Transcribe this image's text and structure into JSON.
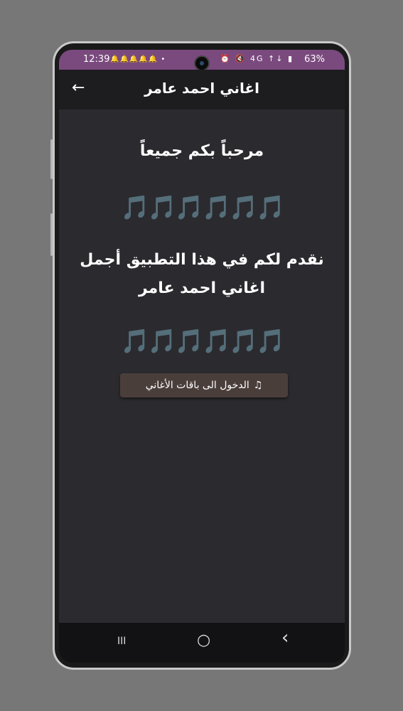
{
  "status": {
    "time": "12:39",
    "left_icons": "🔔🔔🔔🔔🔔 •",
    "right_icons": "⏰ 🔇 4G ↑↓ ▮",
    "battery": "63%"
  },
  "appbar": {
    "back": "←",
    "title": "اغاني احمد عامر"
  },
  "content": {
    "welcome": "مرحباً بكم جميعاً",
    "notes1": "🎵🎵🎵🎵🎵🎵",
    "intro": "نقدم لكم في هذا التطبيق أجمل اغاني احمد عامر",
    "notes2": "🎵🎵🎵🎵🎵🎵",
    "button_icon": "♫",
    "button_label": "الدخول الى باقات الأغاني"
  },
  "navbar": {
    "recents": "III",
    "home": "○",
    "back": "‹"
  }
}
